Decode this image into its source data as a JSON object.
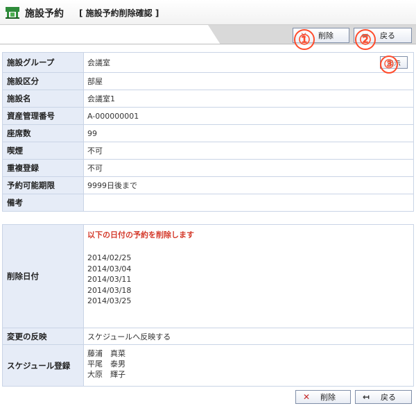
{
  "header": {
    "title": "施設予約",
    "subtitle": "[ 施設予約削除確認 ]"
  },
  "toolbar": {
    "delete_label": "削除",
    "back_label": "戻る"
  },
  "markers": [
    "①",
    "②",
    "③"
  ],
  "facility": {
    "rows": [
      {
        "label": "施設グループ",
        "value": "会議室"
      },
      {
        "label": "施設区分",
        "value": "部屋"
      },
      {
        "label": "施設名",
        "value": "会議室1"
      },
      {
        "label": "資産管理番号",
        "value": "A-000000001"
      },
      {
        "label": "座席数",
        "value": "99"
      },
      {
        "label": "喫煙",
        "value": "不可"
      },
      {
        "label": "重複登録",
        "value": "不可"
      },
      {
        "label": "予約可能期限",
        "value": "9999日後まで"
      },
      {
        "label": "備考",
        "value": ""
      }
    ],
    "show_label": "表示"
  },
  "deletion": {
    "date_label": "削除日付",
    "notice": "以下の日付の予約を削除します",
    "dates": [
      "2014/02/25",
      "2014/03/04",
      "2014/03/11",
      "2014/03/18",
      "2014/03/25"
    ],
    "reflect_label": "変更の反映",
    "reflect_value": "スケジュールへ反映する",
    "schedule_label": "スケジュール登録",
    "schedule_names": [
      "藤浦　真菜",
      "平尾　泰男",
      "大原　輝子"
    ]
  },
  "colors": {
    "accent_red": "#d43a2b",
    "marker_orange": "#ff4b2b",
    "header_cell": "#e6ecf7"
  }
}
